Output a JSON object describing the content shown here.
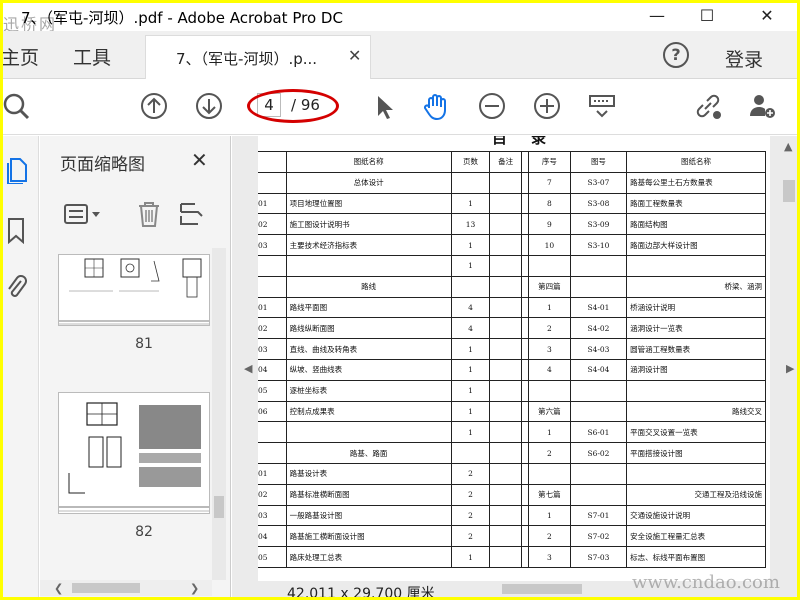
{
  "window": {
    "title": "7、（军屯-河坝）.pdf - Adobe Acrobat Pro DC",
    "watermark_top_left": "迅桥网",
    "watermark_bottom_right": "www.cndao.com"
  },
  "tabs": {
    "home": "主页",
    "tools": "工具",
    "document": "7、（军屯-河坝）.p...",
    "login": "登录"
  },
  "toolbar": {
    "page_current": "4",
    "page_total": "/ 96",
    "highlight_color": "#d40000"
  },
  "sidebar": {
    "panel_title": "页面缩略图",
    "thumbnails": [
      {
        "page_number": "81"
      },
      {
        "page_number": "82"
      }
    ]
  },
  "document": {
    "heading": "目录",
    "page_size": "42.011 x 29.700 厘米",
    "table": {
      "headers": [
        "",
        "图纸名称",
        "页数",
        "备注",
        "序号",
        "图号",
        "图纸名称"
      ],
      "rows": [
        [
          "",
          "总体设计",
          "",
          "",
          "7",
          "S3-07",
          "路基每公里土石方数量表"
        ],
        [
          "01",
          "项目地理位置图",
          "1",
          "",
          "8",
          "S3-08",
          "路面工程数量表"
        ],
        [
          "02",
          "施工图设计说明书",
          "13",
          "",
          "9",
          "S3-09",
          "路面结构图"
        ],
        [
          "03",
          "主要技术经济指标表",
          "1",
          "",
          "10",
          "S3-10",
          "路面边部大样设计图"
        ],
        [
          "",
          "",
          "1",
          "",
          "",
          "",
          ""
        ],
        [
          "",
          "路线",
          "",
          "",
          "第四篇",
          "",
          "桥梁、涵洞"
        ],
        [
          "01",
          "路线平面图",
          "4",
          "",
          "1",
          "S4-01",
          "桥涵设计说明"
        ],
        [
          "02",
          "路线纵断面图",
          "4",
          "",
          "2",
          "S4-02",
          "涵洞设计一览表"
        ],
        [
          "03",
          "直线、曲线及转角表",
          "1",
          "",
          "3",
          "S4-03",
          "圆管涵工程数量表"
        ],
        [
          "04",
          "纵坡、竖曲线表",
          "1",
          "",
          "4",
          "S4-04",
          "涵洞设计图"
        ],
        [
          "05",
          "逐桩坐标表",
          "1",
          "",
          "",
          "",
          ""
        ],
        [
          "06",
          "控制点成果表",
          "1",
          "",
          "第六篇",
          "",
          "路线交叉"
        ],
        [
          "",
          "",
          "1",
          "",
          "1",
          "S6-01",
          "平面交叉设置一览表"
        ],
        [
          "",
          "路基、路面",
          "",
          "",
          "2",
          "S6-02",
          "平面搭接设计图"
        ],
        [
          "01",
          "路基设计表",
          "2",
          "",
          "",
          "",
          ""
        ],
        [
          "02",
          "路基标准横断面图",
          "2",
          "",
          "第七篇",
          "",
          "交通工程及沿线设施"
        ],
        [
          "03",
          "一般路基设计图",
          "2",
          "",
          "1",
          "S7-01",
          "交通设施设计说明"
        ],
        [
          "04",
          "路基施工横断面设计图",
          "2",
          "",
          "2",
          "S7-02",
          "安全设施工程量汇总表"
        ],
        [
          "05",
          "路床处理工总表",
          "1",
          "",
          "3",
          "S7-03",
          "标志、标线平面布置图"
        ]
      ]
    }
  }
}
